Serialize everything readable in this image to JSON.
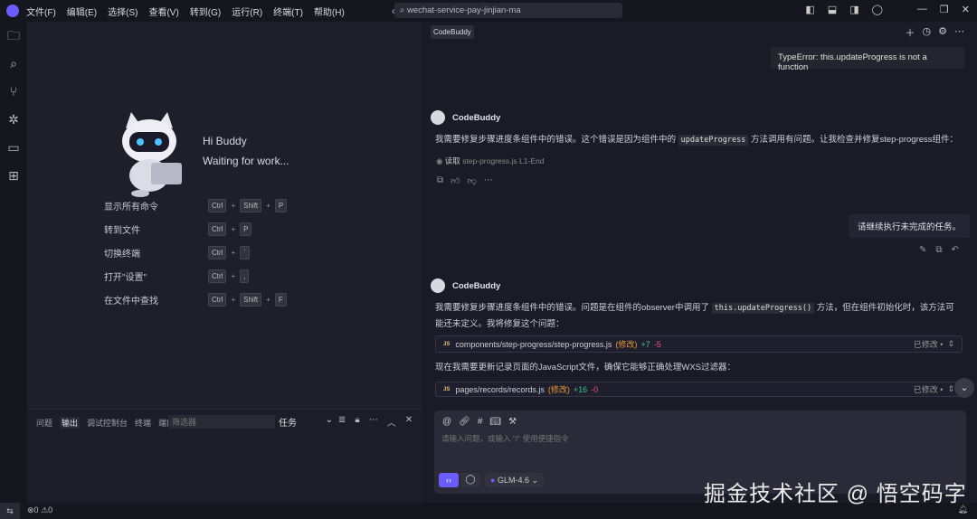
{
  "menu": [
    "文件(F)",
    "编辑(E)",
    "选择(S)",
    "查看(V)",
    "转到(G)",
    "运行(R)",
    "终端(T)",
    "帮助(H)"
  ],
  "search": "wechat-service-pay-jinjian-ma",
  "welcome": {
    "greeting": "Hi Buddy",
    "status": "Waiting for work...",
    "shortcuts": [
      {
        "label": "显示所有命令",
        "keys": [
          "Ctrl",
          "Shift",
          "P"
        ]
      },
      {
        "label": "转到文件",
        "keys": [
          "Ctrl",
          "P"
        ]
      },
      {
        "label": "切换终端",
        "keys": [
          "Ctrl",
          "`"
        ]
      },
      {
        "label": "打开\"设置\"",
        "keys": [
          "Ctrl",
          ","
        ]
      },
      {
        "label": "在文件中查找",
        "keys": [
          "Ctrl",
          "Shift",
          "F"
        ]
      }
    ]
  },
  "panel": {
    "tabs": [
      "问题",
      "输出",
      "调试控制台",
      "终端",
      "端口"
    ],
    "filter_placeholder": "筛选器",
    "task": "任务"
  },
  "status": {
    "errors": "0",
    "warnings": "0"
  },
  "chat": {
    "tag": "CodeBuddy",
    "error": "TypeError: this.updateProgress is not a function",
    "bot": "CodeBuddy",
    "msg1_pre": "我需要修复步骤进度条组件中的错误。这个错误是因为组件中的",
    "msg1_code": "updateProgress",
    "msg1_post": "方法调用有问题。让我检查并修复step-progress组件：",
    "read_label": "读取",
    "read_file": "step-progress.js L1-End",
    "user_msg": "请继续执行未完成的任务。",
    "msg2_pre": "我需要修复步骤进度条组件中的错误。问题是在组件的observer中调用了",
    "msg2_code": "this.updateProgress()",
    "msg2_post": "方法，但在组件初始化时，该方法可能还未定义。我将修复这个问题：",
    "files": [
      {
        "path": "components/step-progress/step-progress.js",
        "tag": "(修改)",
        "add": "+7",
        "del": "-5",
        "state": "已修改 •"
      },
      {
        "path": "pages/records/records.js",
        "tag": "(修改)",
        "add": "+16",
        "del": "-0",
        "state": "已修改 •"
      }
    ],
    "msg3": "现在我需要更新记录页面的JavaScript文件，确保它能够正确处理WXS过滤器：",
    "input_placeholder": "请输入问题，或输入 \"/\" 使用便捷指令",
    "model": "GLM-4.6"
  },
  "watermark": "掘金技术社区 @ 悟空码字",
  "colors": {
    "accent": "#6a5cff",
    "add": "#3ec28a",
    "del": "#e2557a"
  }
}
